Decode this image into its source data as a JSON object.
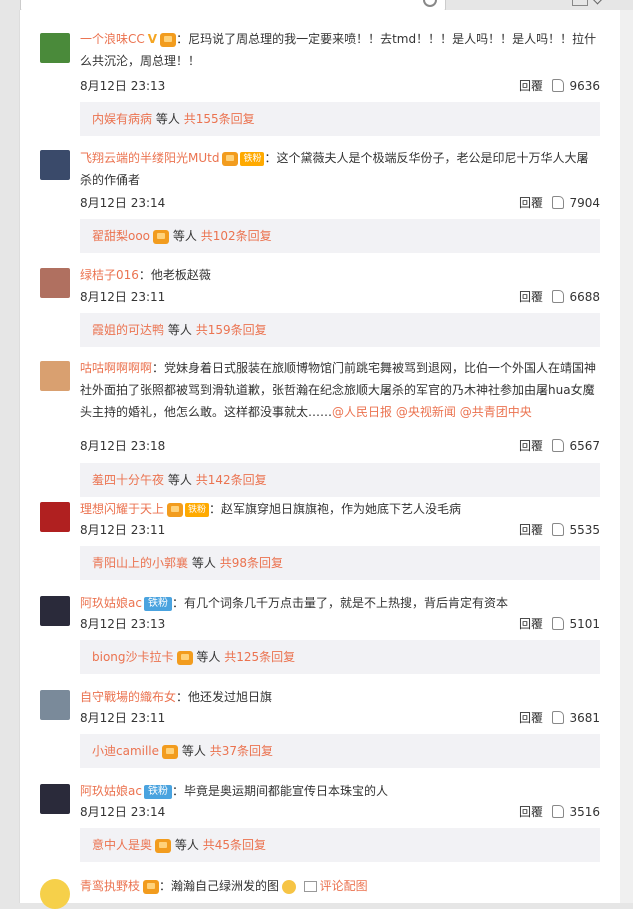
{
  "comments": [
    {
      "user": "一个浪味CC",
      "text": "：尼玛说了周总理的我一定要来喷！！去tmd！！！是人吗！！是人吗！！拉什么共沉沦，周总理！！",
      "time": "8月12日 23:13",
      "reply": "回覆",
      "likes": "9636",
      "sub_who": "内娱有病病",
      "sub_mid": "等人",
      "sub_count": "共155条回复",
      "avatar_color": "#4a8a3a"
    },
    {
      "user": "飞翔云端的半缕阳光MUtd",
      "badge": "铁粉",
      "text": "：这个黛薇夫人是个极端反华份子，老公是印尼十万华人大屠杀的作俑者",
      "time": "8月12日 23:14",
      "reply": "回覆",
      "likes": "7904",
      "sub_who": "翟甜梨ooo",
      "sub_mid": "等人",
      "sub_count": "共102条回复",
      "avatar_color": "#3a4a6a"
    },
    {
      "user": "绿桔子016",
      "text": "：他老板赵薇",
      "time": "8月12日 23:11",
      "reply": "回覆",
      "likes": "6688",
      "sub_who": "霞姐的可达鸭",
      "sub_mid": "等人",
      "sub_count": "共159条回复",
      "avatar_color": "#b07060"
    },
    {
      "user": "咕咕啊啊啊啊",
      "text_a": "：党妹身着日式服装在旅顺博物馆门前跳宅舞被骂到退网，比伯一个外国人在靖国神社外面拍了张照都被骂到滑轨道歉，张哲瀚在纪念旅顺大屠杀的军官的乃木神社参加由屠hua女魔头主持的婚礼，他怎么敢。这样都没事就太……",
      "mentions": [
        "@人民日报",
        "@央视新闻",
        "@共青团中央"
      ],
      "time": "8月12日 23:18",
      "reply": "回覆",
      "likes": "6567",
      "sub_who": "羞四十分午夜",
      "sub_mid": "等人",
      "sub_count": "共142条回复",
      "avatar_color": "#d9a070"
    },
    {
      "user": "理想闪耀于天上",
      "badge": "铁粉",
      "text": "：赵军旗穿旭日旗旗袍，作为她底下艺人没毛病",
      "time": "8月12日 23:11",
      "reply": "回覆",
      "likes": "5535",
      "sub_who": "青阳山上的小郭襄",
      "sub_mid": "等人",
      "sub_count": "共98条回复",
      "avatar_color": "#b02020"
    },
    {
      "user": "阿玖姑娘ac",
      "badge": "铁粉",
      "text": "：有几个词条几千万点击量了，就是不上热搜，背后肯定有资本",
      "time": "8月12日 23:13",
      "reply": "回覆",
      "likes": "5101",
      "sub_who": "biong沙卡拉卡",
      "sub_mid": "等人",
      "sub_count": "共125条回复",
      "avatar_color": "#2a2a3a"
    },
    {
      "user": "自守戰場的織布女",
      "text": "：他还发过旭日旗",
      "time": "8月12日 23:11",
      "reply": "回覆",
      "likes": "3681",
      "sub_who": "小迪camille",
      "sub_mid": "等人",
      "sub_count": "共37条回复",
      "avatar_color": "#7a8a9a"
    },
    {
      "user": "阿玖姑娘ac",
      "badge": "铁粉",
      "text": "：毕竟是奥运期间都能宣传日本珠宝的人",
      "time": "8月12日 23:14",
      "reply": "回覆",
      "likes": "3516",
      "sub_who": "意中人是奥",
      "sub_mid": "等人",
      "sub_count": "共45条回复",
      "avatar_color": "#2a2a3a"
    },
    {
      "user": "青鸾执野枝",
      "text": "：瀚瀚自己绿洲发的图",
      "img_label": "评论配图",
      "avatar_color": "#f6d04a"
    }
  ]
}
